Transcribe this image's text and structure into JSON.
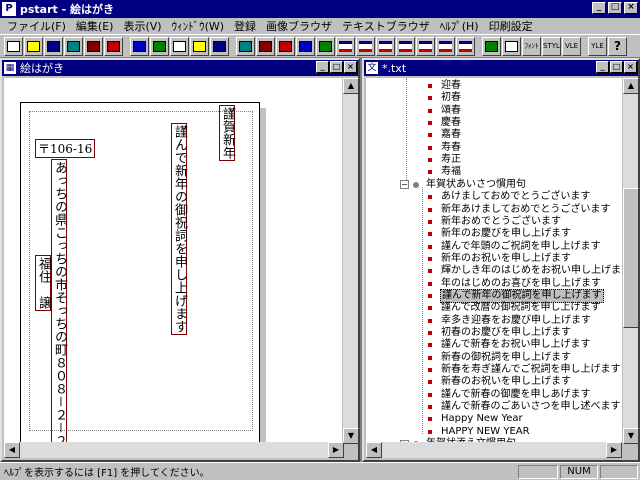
{
  "window": {
    "title": "pstart - 絵はがき",
    "app_icon": "P"
  },
  "menu": [
    "ファイル(F)",
    "編集(E)",
    "表示(V)",
    "ｳｨﾝﾄﾞｳ(W)",
    "登録",
    "画像ブラウザ",
    "テキストブラウザ",
    "ﾍﾙﾌﾟ(H)",
    "印刷設定"
  ],
  "toolbar": {
    "buttons": [
      "new-icon",
      "open-icon",
      "save-icon",
      "print-icon",
      "print-preview-icon",
      "cut-icon",
      "copy-icon",
      "paste-icon",
      "move-icon",
      "flip-icon",
      "image-icon",
      "align-top-icon",
      "align-center-icon",
      "align-horiz-icon",
      "align-left-icon",
      "triangle-icon",
      "layout1-icon",
      "layout2-icon",
      "layout3-icon",
      "layout4-icon",
      "layout5-icon",
      "layout6-icon",
      "layout7-icon",
      "table-icon",
      "stamp-icon",
      "font-icon",
      "style-icon",
      "vle-icon",
      "yle-icon",
      "help-icon"
    ],
    "labels": {
      "font": "ﾌｫﾝﾄ",
      "style": "STYL",
      "vle": "VLE",
      "yle": "YLE"
    }
  },
  "card_window": {
    "title": "絵はがき",
    "postal_code": "〒106-16",
    "address": "あっちの県こっちの市そっちの町８０８－２－２",
    "name": "福住　譲",
    "greeting_main": "謹んで新年の御祝詞を申し上げます",
    "greeting_short": "謹賀新年"
  },
  "tree_window": {
    "title": "*.txt",
    "items_top": [
      "迎春",
      "初春",
      "頌春",
      "慶春",
      "嘉春",
      "寿春",
      "寿正",
      "寿福"
    ],
    "group1": "年賀状あいさつ慣用句",
    "group1_items": [
      "あけましておめでとうございます",
      "新年あけましておめでとうございます",
      "新年おめでとうございます",
      "新年のお慶びを申し上げます",
      "謹んで年頭のご祝詞を申し上げます",
      "新年のお祝いを申し上げます",
      "輝かしき年のはじめをお祝い申し上げます",
      "年のはじめのお喜びを申し上げます",
      "謹んで新年の御祝詞を申し上げます",
      "謹んで改暦の御祝詞を申し上げます",
      "幸多き迎春をお慶び申し上げます",
      "初春のお慶びを申し上げます",
      "謹んで新春をお祝い申し上げます",
      "新春の御祝詞を申し上げます",
      "新春を寿ぎ謹んでご祝詞を申し上げます",
      "新春のお祝いを申し上げます",
      "謹んで新春の御慶を申しあげます",
      "謹んで新春のごあいさつを申し述べます",
      "Happy New Year",
      "HAPPY NEW YEAR"
    ],
    "selected_index": 8,
    "group2": "年賀状添え文慣用句"
  },
  "status": {
    "help_text": "ﾍﾙﾌﾟを表示するには [F1] を押してください。",
    "num": "NUM"
  }
}
